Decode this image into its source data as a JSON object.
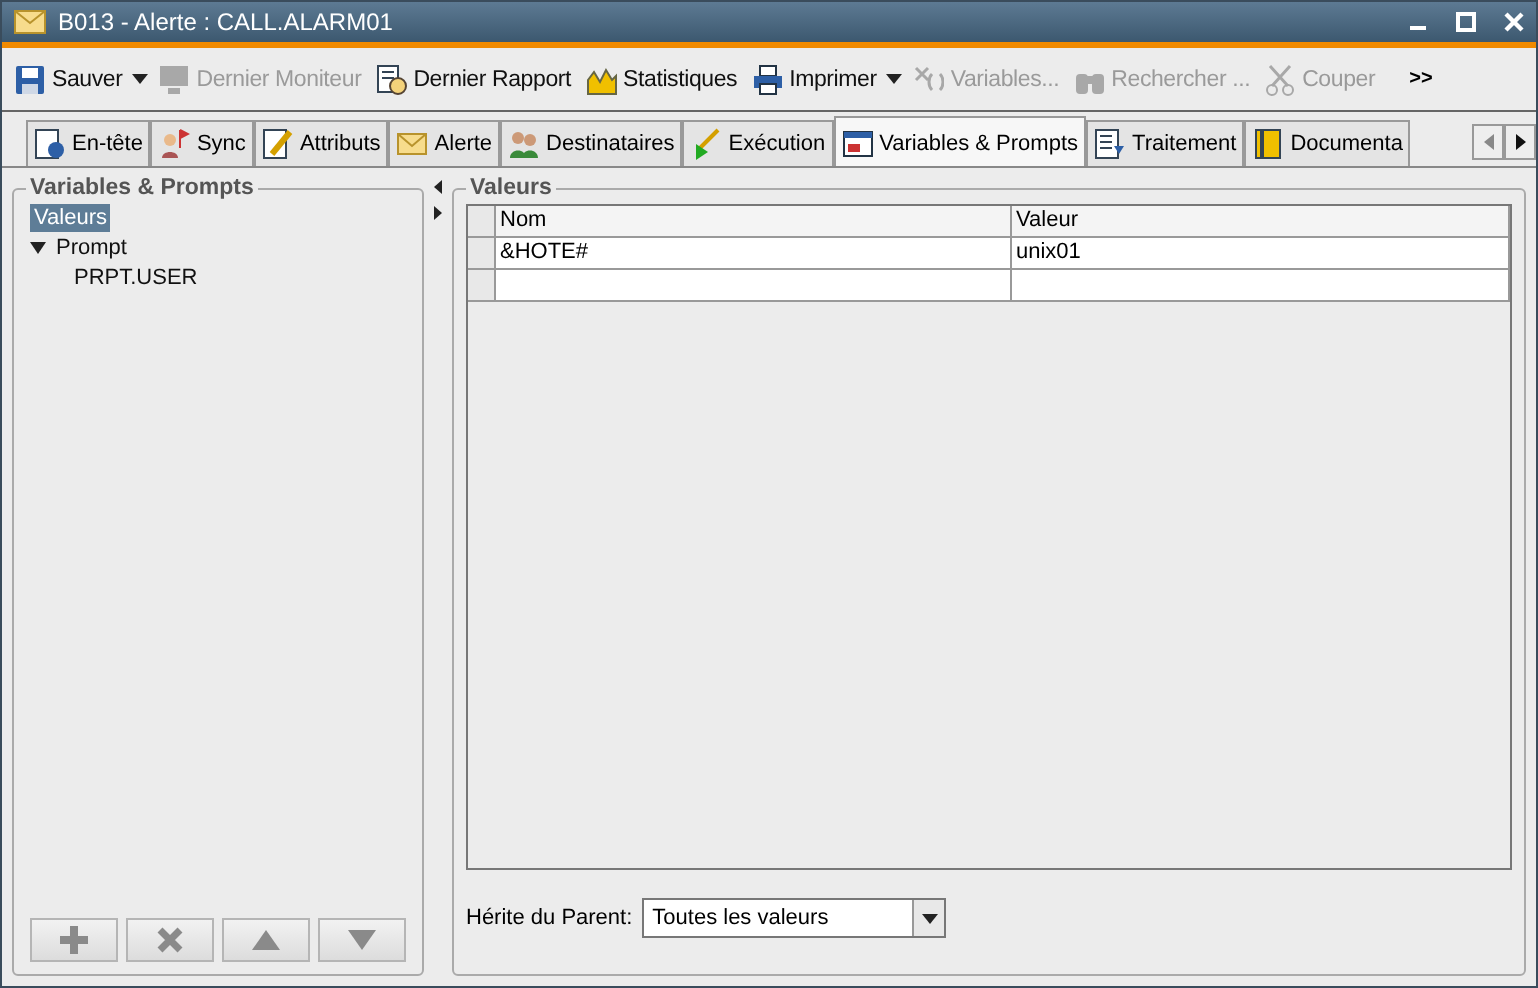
{
  "window": {
    "title": "B013 - Alerte : CALL.ALARM01"
  },
  "toolbar": [
    {
      "label": "Sauver",
      "disabled": false,
      "dropdown": true
    },
    {
      "label": "Dernier Moniteur",
      "disabled": true,
      "dropdown": false
    },
    {
      "label": "Dernier Rapport",
      "disabled": false,
      "dropdown": false
    },
    {
      "label": "Statistiques",
      "disabled": false,
      "dropdown": false
    },
    {
      "label": "Imprimer",
      "disabled": false,
      "dropdown": true
    },
    {
      "label": "Variables...",
      "disabled": true,
      "dropdown": false
    },
    {
      "label": "Rechercher ...",
      "disabled": true,
      "dropdown": false
    },
    {
      "label": "Couper",
      "disabled": true,
      "dropdown": false
    }
  ],
  "toolbar_more": ">>",
  "tabs": [
    {
      "label": "En-tête",
      "selected": false
    },
    {
      "label": "Sync",
      "selected": false
    },
    {
      "label": "Attributs",
      "selected": false
    },
    {
      "label": "Alerte",
      "selected": false
    },
    {
      "label": "Destinataires",
      "selected": false
    },
    {
      "label": "Exécution",
      "selected": false
    },
    {
      "label": "Variables & Prompts",
      "selected": true
    },
    {
      "label": "Traitement",
      "selected": false
    },
    {
      "label": "Documenta",
      "selected": false
    }
  ],
  "left_panel": {
    "title": "Variables & Prompts",
    "tree": [
      {
        "label": "Valeurs",
        "selected": true
      },
      {
        "label": "Prompt",
        "selected": false,
        "expanded": true,
        "children": [
          {
            "label": "PRPT.USER",
            "selected": false
          }
        ]
      }
    ],
    "buttons": [
      {
        "kind": "add",
        "disabled": true
      },
      {
        "kind": "delete",
        "disabled": true
      },
      {
        "kind": "up",
        "disabled": true
      },
      {
        "kind": "down",
        "disabled": true
      }
    ]
  },
  "right_panel": {
    "title": "Valeurs",
    "table": {
      "columns": [
        "Nom",
        "Valeur"
      ],
      "rows": [
        [
          "&HOTE#",
          "unix01"
        ],
        [
          "",
          ""
        ]
      ]
    },
    "inherit": {
      "label": "Hérite du Parent:",
      "value": "Toutes les valeurs"
    }
  }
}
